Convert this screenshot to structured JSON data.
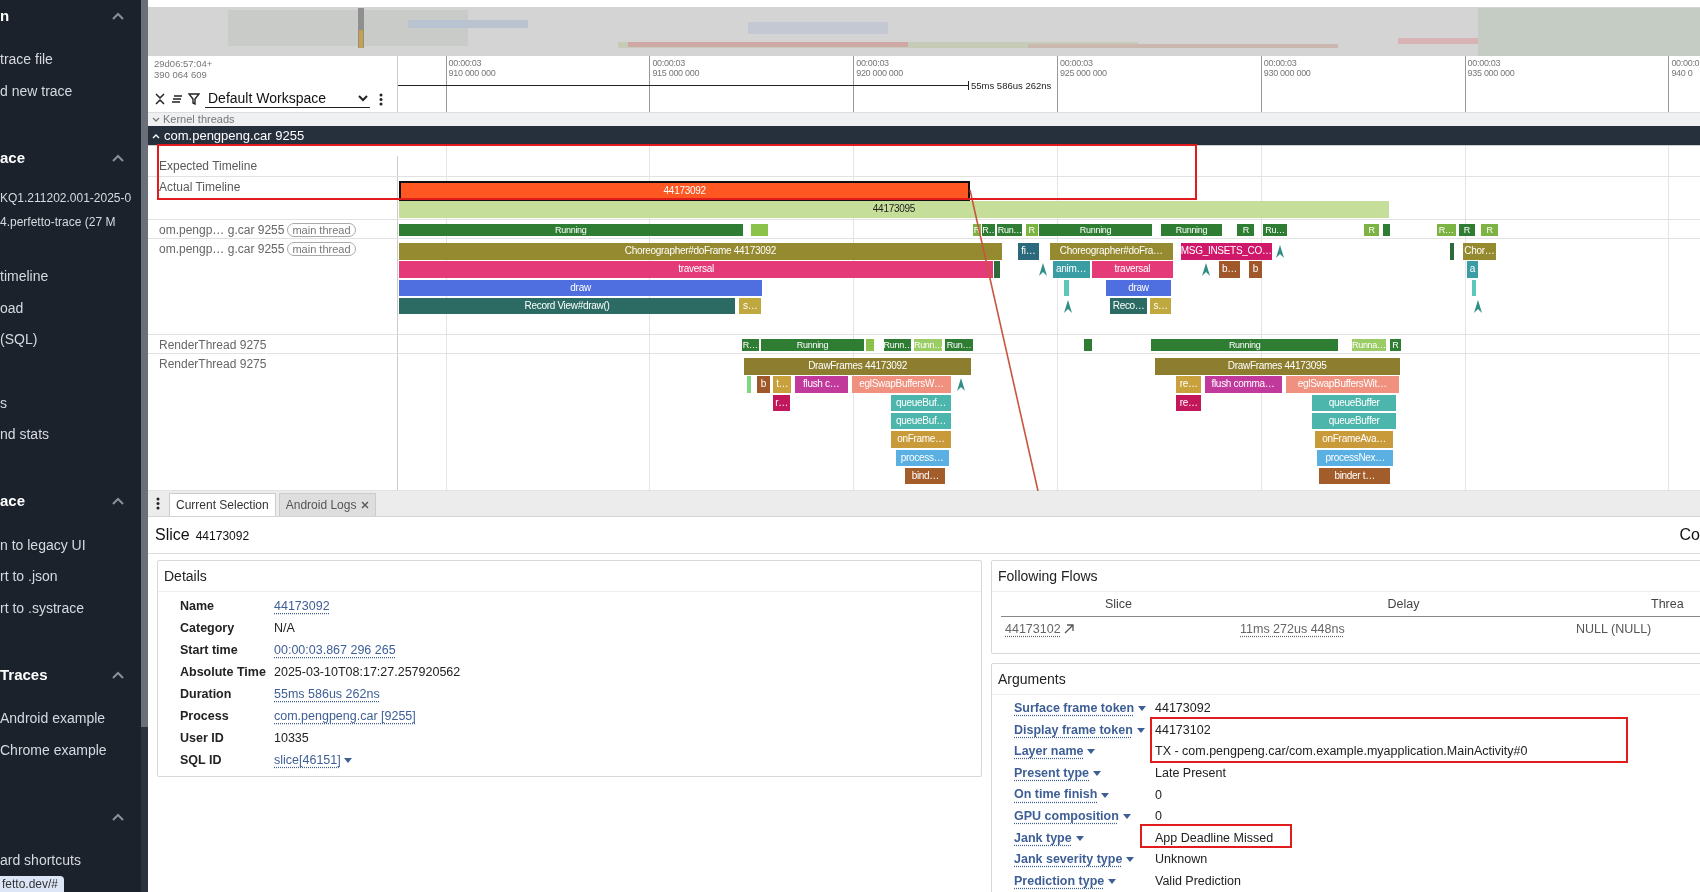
{
  "sidebar": {
    "sections": [
      {
        "title": "n",
        "expanded": true,
        "groups": [
          {
            "kind": "links",
            "items": [
              "trace file",
              "d new trace"
            ]
          }
        ]
      },
      {
        "title": "ace",
        "expanded": true,
        "groups": [
          {
            "kind": "info",
            "items": [
              "KQ1.211202.001-2025-0",
              "4.perfetto-trace (27 M"
            ]
          },
          {
            "kind": "links",
            "items": [
              "timeline",
              "oad",
              "(SQL)"
            ]
          },
          {
            "kind": "links",
            "items": [
              "s",
              "nd stats"
            ]
          }
        ]
      },
      {
        "title": "ace",
        "expanded": true,
        "groups": [
          {
            "kind": "links",
            "items": [
              "n to legacy UI",
              "rt to .json",
              "rt to .systrace"
            ]
          }
        ]
      },
      {
        "title": "Traces",
        "expanded": true,
        "groups": [
          {
            "kind": "links",
            "items": [
              "Android example",
              "Chrome example"
            ]
          }
        ]
      },
      {
        "expanded": true,
        "groups": [
          {
            "kind": "links",
            "items": [
              "ard shortcuts"
            ]
          }
        ]
      }
    ]
  },
  "status_url": "fetto.dev/#",
  "time_axis": {
    "origin": [
      "29d06:57:04+",
      "390 064 609"
    ],
    "measurement": "55ms 586us 262ns",
    "ticks": [
      {
        "time": "00:00:03",
        "offset": "910 000 000"
      },
      {
        "time": "00:00:03",
        "offset": "915 000 000"
      },
      {
        "time": "00:00:03",
        "offset": "920 000 000"
      },
      {
        "time": "00:00:03",
        "offset": "925 000 000"
      },
      {
        "time": "00:00:03",
        "offset": "930 000 000"
      },
      {
        "time": "00:00:03",
        "offset": "935 000 000"
      },
      {
        "time": "00:00:0",
        "offset": "940 0"
      }
    ]
  },
  "workspace": "Default Workspace",
  "collapsed_group": {
    "title": "Kernel threads",
    "expanded": false
  },
  "process": {
    "title": "com.pengpeng.car 9255",
    "expanded": true
  },
  "tracks": [
    {
      "kind": "frames",
      "label": "Expected Timeline"
    },
    {
      "kind": "frames",
      "label": "Actual Timeline",
      "slices": [
        {
          "label": "44173092",
          "color": "#ff5722",
          "selected": true
        },
        {
          "label": "44173095",
          "color": "#c5df9a",
          "selected": false
        }
      ]
    },
    {
      "kind": "state",
      "label": "om.pengp… g.car 9255",
      "tag": "main thread",
      "slices": [
        {
          "label": "Running",
          "color": "#2e7d32"
        },
        {
          "color": "#8bc34a"
        },
        {
          "label": "R",
          "color": "#7cb342"
        },
        {
          "label": "R…",
          "color": "#2e7d32"
        },
        {
          "label": "Run…",
          "color": "#2e7d32"
        },
        {
          "label": "R",
          "color": "#7cb342"
        },
        {
          "label": "Running",
          "color": "#2e7d32"
        },
        {
          "label": "Running",
          "color": "#2e7d32"
        },
        {
          "label": "R",
          "color": "#2e7d32"
        },
        {
          "label": "Ru…",
          "color": "#2e7d32"
        },
        {
          "label": "R",
          "color": "#7cb342"
        },
        {
          "color": "#2e7d32"
        },
        {
          "label": "R…",
          "color": "#7cb342"
        },
        {
          "label": "R",
          "color": "#2e7d32"
        },
        {
          "label": "R",
          "color": "#7cb342"
        }
      ]
    },
    {
      "kind": "slices",
      "label": "om.pengp… g.car 9255",
      "tag": "main thread",
      "slices": [
        {
          "label": "Choreographer#doFrame 44173092",
          "color": "#958a2f"
        },
        {
          "label": "fi…",
          "color": "#2b6a7c"
        },
        {
          "label": "Choreographer#doFra…",
          "color": "#958a2f"
        },
        {
          "label": "MSG_INSETS_CO…",
          "color": "#d0186a"
        },
        {
          "color": "#2e6b3a"
        },
        {
          "label": "Chor…",
          "color": "#958a2f"
        },
        {
          "label": "traversal",
          "color": "#e43a77"
        },
        {
          "color": "#2e6b3a"
        },
        {
          "label": "anim…",
          "color": "#3a9da3"
        },
        {
          "label": "traversal",
          "color": "#e43a77"
        },
        {
          "label": "b…",
          "color": "#a0582b"
        },
        {
          "label": "b",
          "color": "#a0582b"
        },
        {
          "label": "a",
          "color": "#3a9da3"
        },
        {
          "label": "draw",
          "color": "#4f6fe0"
        },
        {
          "color": "#5cc6b8"
        },
        {
          "label": "draw",
          "color": "#4f6fe0"
        },
        {
          "color": "#5cc6b8"
        },
        {
          "label": "Record View#draw()",
          "color": "#2c6b64"
        },
        {
          "label": "s…",
          "color": "#bfa83e"
        },
        {
          "label": "Reco…",
          "color": "#2c6b64"
        },
        {
          "label": "s…",
          "color": "#bfa83e"
        }
      ]
    },
    {
      "kind": "state",
      "label": "RenderThread 9275",
      "slices": [
        {
          "label": "R…",
          "color": "#2e7d32"
        },
        {
          "label": "Running",
          "color": "#2e7d32"
        },
        {
          "color": "#8bc34a"
        },
        {
          "label": "Runn…",
          "color": "#2e7d32"
        },
        {
          "label": "Runn…",
          "color": "#9ccc65"
        },
        {
          "label": "Run…",
          "color": "#2e7d32"
        },
        {
          "color": "#2e7d32"
        },
        {
          "label": "Running",
          "color": "#2e7d32"
        },
        {
          "label": "Runna…",
          "color": "#9ccc65"
        },
        {
          "label": "R",
          "color": "#2e7d32"
        }
      ]
    },
    {
      "kind": "slices",
      "label": "RenderThread 9275",
      "slices": [
        {
          "label": "DrawFrames 44173092",
          "color": "#8c7d2f"
        },
        {
          "label": "DrawFrames 44173095",
          "color": "#8c7d2f"
        },
        {
          "color": "#7ed67e"
        },
        {
          "label": "b",
          "color": "#a0582b"
        },
        {
          "label": "t…",
          "color": "#c9a13c"
        },
        {
          "label": "flush c…",
          "color": "#c2399c"
        },
        {
          "label": "eglSwapBuffersW…",
          "color": "#f0907e"
        },
        {
          "label": "re…",
          "color": "#c9a13c"
        },
        {
          "label": "flush comma…",
          "color": "#c2399c"
        },
        {
          "label": "eglSwapBuffersWit…",
          "color": "#f0907e"
        },
        {
          "label": "r…",
          "color": "#c2185b"
        },
        {
          "label": "queueBuf…",
          "color": "#4db6ac"
        },
        {
          "label": "re…",
          "color": "#c2185b"
        },
        {
          "label": "queueBuffer",
          "color": "#4db6ac"
        },
        {
          "label": "queueBuf…",
          "color": "#4db6ac"
        },
        {
          "label": "queueBuffer",
          "color": "#4db6ac"
        },
        {
          "label": "onFrame…",
          "color": "#c99a3a"
        },
        {
          "label": "onFrameAva…",
          "color": "#c99a3a"
        },
        {
          "label": "process…",
          "color": "#5ab0e3"
        },
        {
          "label": "processNex…",
          "color": "#5ab0e3"
        },
        {
          "label": "bind…",
          "color": "#a35d2a"
        },
        {
          "label": "binder t…",
          "color": "#a35d2a"
        }
      ]
    }
  ],
  "panel": {
    "tabs": [
      {
        "label": "Current Selection",
        "selected": true,
        "closable": false
      },
      {
        "label": "Android Logs",
        "selected": false,
        "closable": true
      }
    ],
    "heading": {
      "title": "Slice",
      "id": "44173092",
      "right": "Co"
    },
    "details": {
      "title": "Details",
      "rows": [
        {
          "key": "Name",
          "value": "44173092",
          "kind": "link"
        },
        {
          "key": "Category",
          "value": "N/A",
          "kind": "text"
        },
        {
          "key": "Start time",
          "value": "00:00:03.867 296 265",
          "kind": "link"
        },
        {
          "key": "Absolute Time",
          "value": "2025-03-10T08:17:27.257920562",
          "kind": "text"
        },
        {
          "key": "Duration",
          "value": "55ms 586us 262ns",
          "kind": "link"
        },
        {
          "key": "Process",
          "value": "com.pengpeng.car [9255]",
          "kind": "link"
        },
        {
          "key": "User ID",
          "value": "10335",
          "kind": "text"
        },
        {
          "key": "SQL ID",
          "value": "slice[46151]",
          "kind": "menu"
        }
      ]
    },
    "flows": {
      "title": "Following Flows",
      "columns": [
        "Slice",
        "Delay",
        "Threa"
      ],
      "rows": [
        {
          "cells": [
            {
              "text": "44173102",
              "kind": "jump"
            },
            {
              "text": "11ms 272us 448ns",
              "kind": "link"
            },
            {
              "text": "NULL (NULL)",
              "kind": "text"
            }
          ]
        }
      ]
    },
    "arguments": {
      "title": "Arguments",
      "rows": [
        {
          "key": "Surface frame token",
          "value": "44173092"
        },
        {
          "key": "Display frame token",
          "value": "44173102"
        },
        {
          "key": "Layer name",
          "value": "TX - com.pengpeng.car/com.example.myapplication.MainActivity#0"
        },
        {
          "key": "Present type",
          "value": "Late Present"
        },
        {
          "key": "On time finish",
          "value": "0"
        },
        {
          "key": "GPU composition",
          "value": "0"
        },
        {
          "key": "Jank type",
          "value": "App Deadline Missed"
        },
        {
          "key": "Jank severity type",
          "value": "Unknown"
        },
        {
          "key": "Prediction type",
          "value": "Valid Prediction"
        }
      ]
    }
  }
}
